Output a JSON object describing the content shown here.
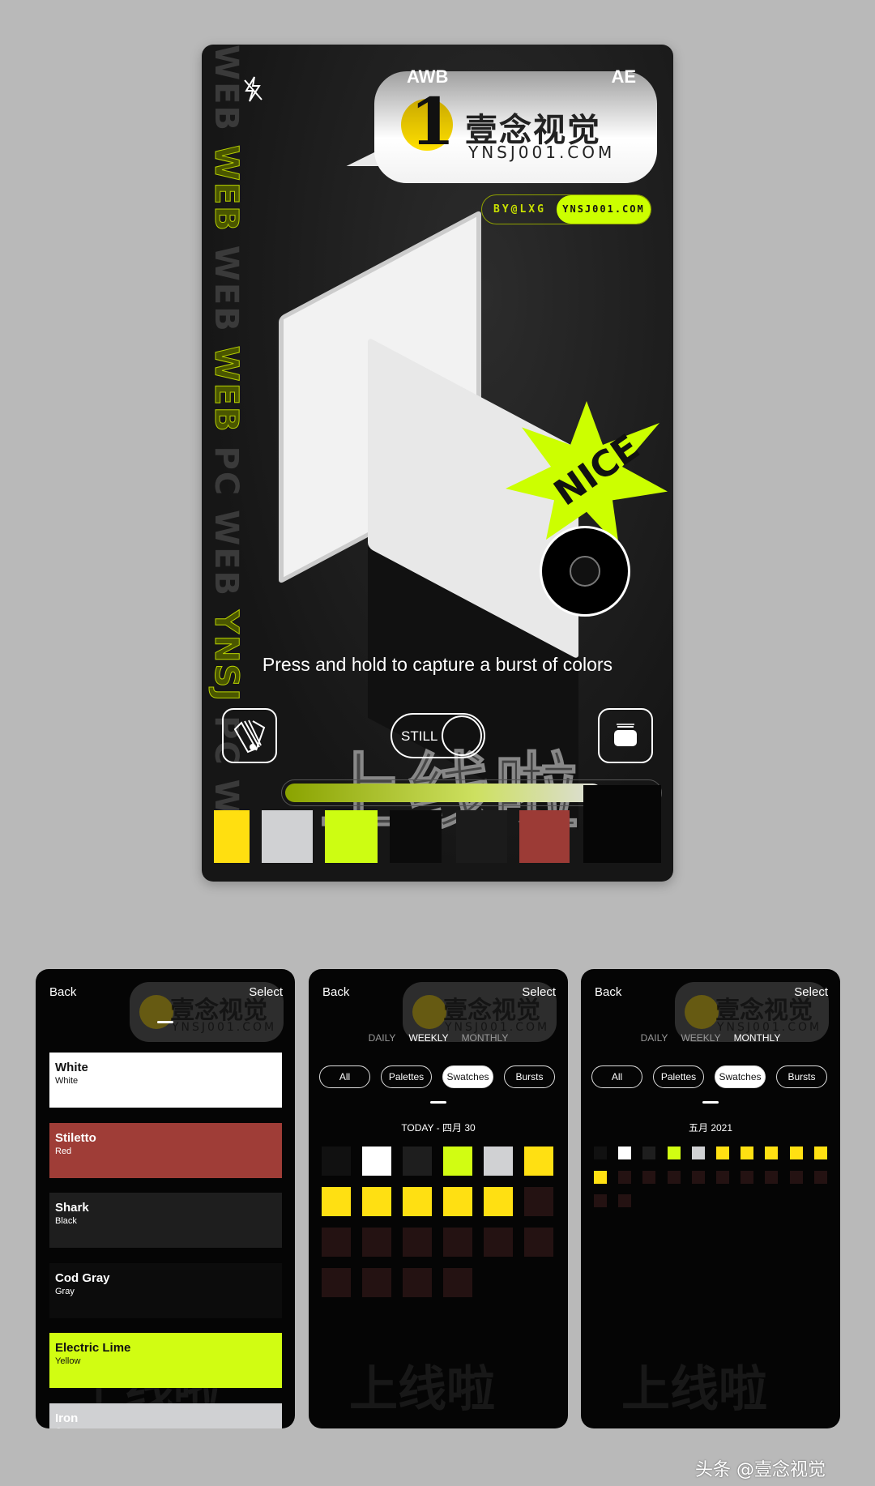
{
  "main": {
    "badge_left": "AWB",
    "badge_right": "AE",
    "brand_cn": "壹念视觉",
    "brand_url": "YNSJ001.COM",
    "by_label": "BY@LXG",
    "by_url": "YNSJ001.COM",
    "vertical_text": [
      "WEB",
      "WEB",
      "WEB",
      "WEB",
      "PC",
      "WEB",
      "YNSJ",
      "PC",
      "WE"
    ],
    "sticker": "NICE",
    "hint": "Press and hold to capture a burst of colors",
    "mode_toggle": "STILL",
    "overlay_cn": "上线啦",
    "burst_progress": 0.85,
    "icons": {
      "flash": "flash-off-icon",
      "left": "swatch-fan-icon",
      "right": "library-stack-icon"
    },
    "captured_colors": [
      "#ffdf10",
      "#d0d1d3",
      "#cdfd12",
      "#0b0b0b",
      "#1b1b1b",
      "#9c3b36",
      "#060606"
    ]
  },
  "screens": [
    {
      "back": "Back",
      "select": "Select",
      "colors": [
        {
          "name": "White",
          "family": "White",
          "hex": "#ffffff",
          "text": "#111111"
        },
        {
          "name": "Stiletto",
          "family": "Red",
          "hex": "#9f3d37",
          "text": "#ffffff"
        },
        {
          "name": "Shark",
          "family": "Black",
          "hex": "#1e1e1e",
          "text": "#ffffff"
        },
        {
          "name": "Cod Gray",
          "family": "Gray",
          "hex": "#0c0c0c",
          "text": "#ffffff"
        },
        {
          "name": "Electric Lime",
          "family": "Yellow",
          "hex": "#d1fd12",
          "text": "#111111"
        },
        {
          "name": "Iron",
          "family": "Gray",
          "hex": "#d0d1d3",
          "text": "#ffffff"
        }
      ]
    },
    {
      "back": "Back",
      "select": "Select",
      "periods": [
        "DAILY",
        "WEEKLY",
        "MONTHLY"
      ],
      "active_period": "WEEKLY",
      "filters": [
        "All",
        "Palettes",
        "Swatches",
        "Bursts"
      ],
      "active_filter": "Swatches",
      "title": "TODAY - 四月 30",
      "swatches": [
        "#111111",
        "#ffffff",
        "#1e1e1e",
        "#d1fd12",
        "#d0d1d3",
        "#ffe012",
        "#ffe012",
        "#ffe012",
        "#ffe012",
        "#ffe012",
        "#ffe012",
        "#241212",
        "#241212",
        "#241212",
        "#241212",
        "#241212",
        "#241212",
        "#241212",
        "#241212",
        "#241212",
        "#241212",
        "#241212"
      ]
    },
    {
      "back": "Back",
      "select": "Select",
      "periods": [
        "DAILY",
        "WEEKLY",
        "MONTHLY"
      ],
      "active_period": "MONTHLY",
      "filters": [
        "All",
        "Palettes",
        "Swatches",
        "Bursts"
      ],
      "active_filter": "Swatches",
      "title": "五月 2021",
      "swatches": [
        "#111111",
        "#ffffff",
        "#1e1e1e",
        "#d1fd12",
        "#d0d1d3",
        "#ffe012",
        "#ffe012",
        "#ffe012",
        "#ffe012",
        "#ffe012",
        "#ffe012",
        "#241212",
        "#241212",
        "#241212",
        "#241212",
        "#241212",
        "#241212",
        "#241212",
        "#241212",
        "#241212",
        "#241212",
        "#241212"
      ]
    }
  ],
  "watermark": "头条 @壹念视觉"
}
